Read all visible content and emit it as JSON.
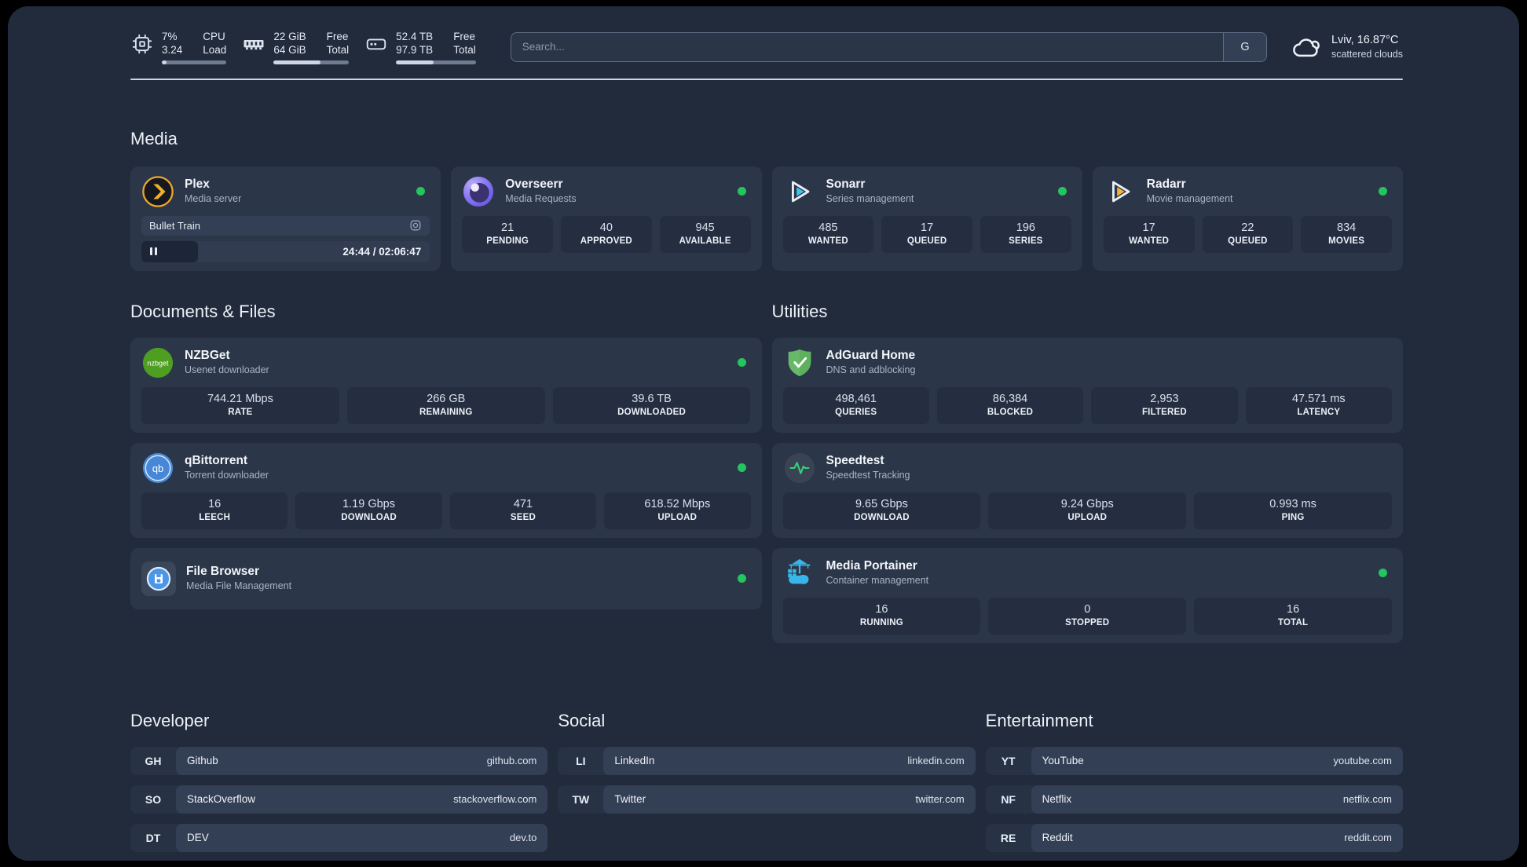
{
  "header": {
    "system_stats": [
      {
        "icon": "cpu-icon",
        "values": [
          "7%",
          "3.24"
        ],
        "labels": [
          "CPU",
          "Load"
        ],
        "progress_pct": 7
      },
      {
        "icon": "ram-icon",
        "values": [
          "22 GiB",
          "64 GiB"
        ],
        "labels": [
          "Free",
          "Total"
        ],
        "progress_pct": 62
      },
      {
        "icon": "disk-icon",
        "values": [
          "52.4 TB",
          "97.9 TB"
        ],
        "labels": [
          "Free",
          "Total"
        ],
        "progress_pct": 47
      }
    ],
    "search": {
      "placeholder": "Search...",
      "engine_button": "G"
    },
    "weather": {
      "location": "Lviv, 16.87°C",
      "condition": "scattered clouds"
    }
  },
  "sections": {
    "media": {
      "title": "Media"
    },
    "documents": {
      "title": "Documents & Files"
    },
    "utilities": {
      "title": "Utilities"
    },
    "developer": {
      "title": "Developer"
    },
    "social": {
      "title": "Social"
    },
    "entertainment": {
      "title": "Entertainment"
    }
  },
  "apps": {
    "plex": {
      "name": "Plex",
      "description": "Media server",
      "online": true,
      "now_playing": {
        "title": "Bullet Train",
        "time_display": "24:44 / 02:06:47",
        "progress_pct": 19.5
      }
    },
    "overseerr": {
      "name": "Overseerr",
      "description": "Media Requests",
      "online": true,
      "stats": [
        {
          "value": "21",
          "label": "PENDING"
        },
        {
          "value": "40",
          "label": "APPROVED"
        },
        {
          "value": "945",
          "label": "AVAILABLE"
        }
      ]
    },
    "sonarr": {
      "name": "Sonarr",
      "description": "Series management",
      "online": true,
      "stats": [
        {
          "value": "485",
          "label": "WANTED"
        },
        {
          "value": "17",
          "label": "QUEUED"
        },
        {
          "value": "196",
          "label": "SERIES"
        }
      ]
    },
    "radarr": {
      "name": "Radarr",
      "description": "Movie management",
      "online": true,
      "stats": [
        {
          "value": "17",
          "label": "WANTED"
        },
        {
          "value": "22",
          "label": "QUEUED"
        },
        {
          "value": "834",
          "label": "MOVIES"
        }
      ]
    },
    "nzbget": {
      "name": "NZBGet",
      "description": "Usenet downloader",
      "online": true,
      "stats": [
        {
          "value": "744.21 Mbps",
          "label": "RATE"
        },
        {
          "value": "266 GB",
          "label": "REMAINING"
        },
        {
          "value": "39.6 TB",
          "label": "DOWNLOADED"
        }
      ]
    },
    "qbittorrent": {
      "name": "qBittorrent",
      "description": "Torrent downloader",
      "online": true,
      "stats": [
        {
          "value": "16",
          "label": "LEECH"
        },
        {
          "value": "1.19 Gbps",
          "label": "DOWNLOAD"
        },
        {
          "value": "471",
          "label": "SEED"
        },
        {
          "value": "618.52 Mbps",
          "label": "UPLOAD"
        }
      ]
    },
    "filebrowser": {
      "name": "File Browser",
      "description": "Media File Management",
      "online": true
    },
    "adguard": {
      "name": "AdGuard Home",
      "description": "DNS and adblocking",
      "stats": [
        {
          "value": "498,461",
          "label": "QUERIES"
        },
        {
          "value": "86,384",
          "label": "BLOCKED"
        },
        {
          "value": "2,953",
          "label": "FILTERED"
        },
        {
          "value": "47.571 ms",
          "label": "LATENCY"
        }
      ]
    },
    "speedtest": {
      "name": "Speedtest",
      "description": "Speedtest Tracking",
      "stats": [
        {
          "value": "9.65 Gbps",
          "label": "DOWNLOAD"
        },
        {
          "value": "9.24 Gbps",
          "label": "UPLOAD"
        },
        {
          "value": "0.993 ms",
          "label": "PING"
        }
      ]
    },
    "portainer": {
      "name": "Media Portainer",
      "description": "Container management",
      "online": true,
      "stats": [
        {
          "value": "16",
          "label": "RUNNING"
        },
        {
          "value": "0",
          "label": "STOPPED"
        },
        {
          "value": "16",
          "label": "TOTAL"
        }
      ]
    }
  },
  "bookmarks": {
    "developer": [
      {
        "abbr": "GH",
        "name": "Github",
        "url": "github.com"
      },
      {
        "abbr": "SO",
        "name": "StackOverflow",
        "url": "stackoverflow.com"
      },
      {
        "abbr": "DT",
        "name": "DEV",
        "url": "dev.to"
      }
    ],
    "social": [
      {
        "abbr": "LI",
        "name": "LinkedIn",
        "url": "linkedin.com"
      },
      {
        "abbr": "TW",
        "name": "Twitter",
        "url": "twitter.com"
      }
    ],
    "entertainment": [
      {
        "abbr": "YT",
        "name": "YouTube",
        "url": "youtube.com"
      },
      {
        "abbr": "NF",
        "name": "Netflix",
        "url": "netflix.com"
      },
      {
        "abbr": "RE",
        "name": "Reddit",
        "url": "reddit.com"
      }
    ]
  },
  "colors": {
    "background": "#212b3c",
    "card": "#2b3648",
    "stat_box": "#242e40",
    "online_dot": "#22c55e",
    "text": "#eef2f8",
    "muted_text": "#a9b4c7"
  }
}
